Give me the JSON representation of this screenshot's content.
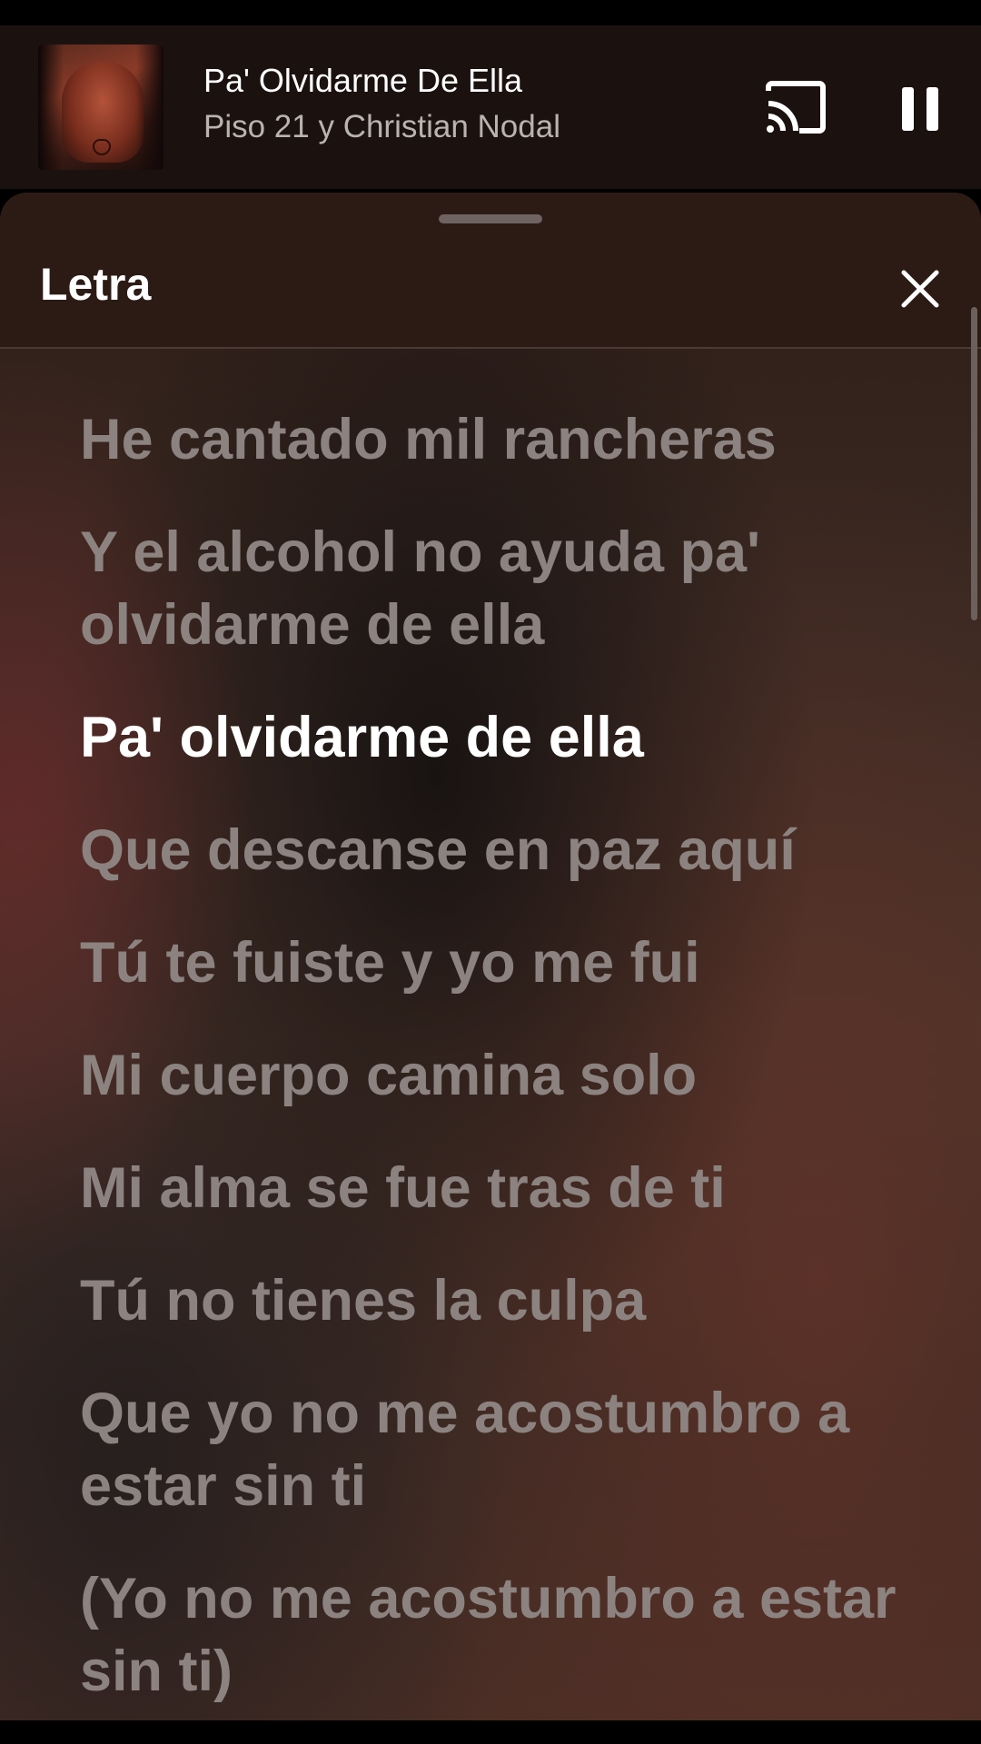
{
  "now_playing": {
    "title": "Pa' Olvidarme De Ella",
    "artist": "Piso 21 y Christian Nodal",
    "artwork_icon": "album-art"
  },
  "controls": {
    "cast_icon": "cast-icon",
    "pause_icon": "pause-icon"
  },
  "lyrics_sheet": {
    "title": "Letra",
    "close_icon": "close-icon",
    "active_line_index": 2,
    "lines": [
      "He cantado mil rancheras",
      "Y el alcohol no ayuda pa' olvidarme de ella",
      "Pa' olvidarme de ella",
      "Que descanse en paz aquí",
      "Tú te fuiste y yo me fui",
      "Mi cuerpo camina solo",
      "Mi alma se fue tras de ti",
      "Tú no tienes la culpa",
      "Que yo no me acostumbro a estar sin ti",
      "(Yo no me acostumbro a estar sin ti)"
    ]
  },
  "colors": {
    "active_lyric": "#ffffff",
    "inactive_lyric": "#8c8380",
    "artist_text": "#b9b3b1"
  }
}
